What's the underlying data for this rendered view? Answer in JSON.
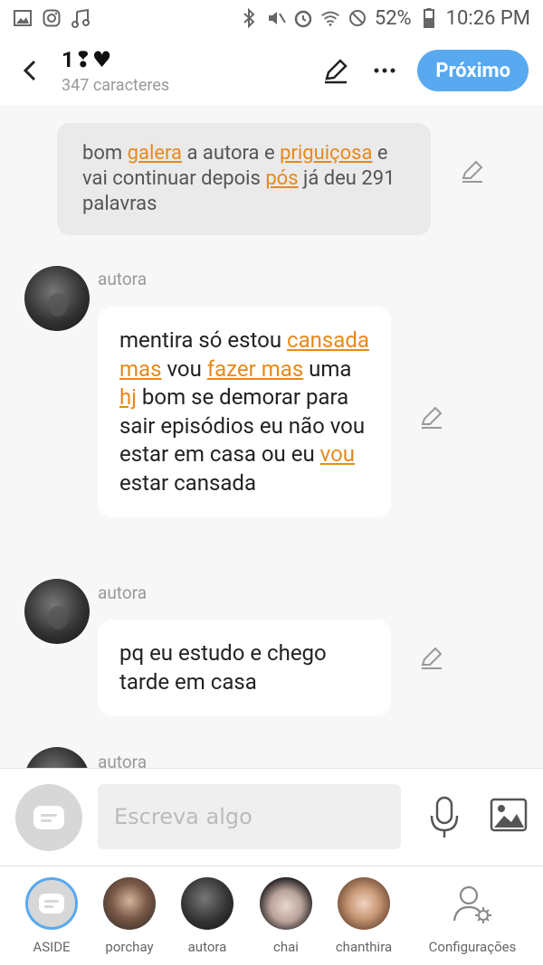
{
  "status": {
    "battery": "52%",
    "time": "10:26 PM"
  },
  "header": {
    "title": "1❢♥",
    "subtitle": "347 caracteres",
    "next_label": "Próximo"
  },
  "messages": [
    {
      "type": "system",
      "segments": [
        {
          "t": "bom ",
          "u": false
        },
        {
          "t": "galera",
          "u": true
        },
        {
          "t": " a autora e ",
          "u": false
        },
        {
          "t": "priguiçosa",
          "u": true
        },
        {
          "t": " e vai continuar depois ",
          "u": false
        },
        {
          "t": "pós",
          "u": true
        },
        {
          "t": " já deu 291 palavras",
          "u": false
        }
      ]
    },
    {
      "type": "message",
      "sender": "autora",
      "segments": [
        {
          "t": "mentira só estou ",
          "u": false
        },
        {
          "t": "cansada mas",
          "u": true
        },
        {
          "t": " vou ",
          "u": false
        },
        {
          "t": "fazer mas",
          "u": true
        },
        {
          "t": " uma ",
          "u": false
        },
        {
          "t": "hj",
          "u": true
        },
        {
          "t": " bom se demorar para sair episódios eu não vou estar em casa ou eu ",
          "u": false
        },
        {
          "t": "vou",
          "u": true
        },
        {
          "t": " estar cansada",
          "u": false
        }
      ]
    },
    {
      "type": "message",
      "sender": "autora",
      "segments": [
        {
          "t": "pq eu estudo e chego tarde em casa",
          "u": false
        }
      ]
    },
    {
      "type": "message",
      "sender": "autora",
      "segments": []
    }
  ],
  "composer": {
    "placeholder": "Escreva algo"
  },
  "nav": [
    {
      "label": "ASIDE",
      "icon": "aside-icon"
    },
    {
      "label": "porchay",
      "icon": "avatar"
    },
    {
      "label": "autora",
      "icon": "avatar"
    },
    {
      "label": "chai",
      "icon": "avatar"
    },
    {
      "label": "chanthira",
      "icon": "avatar"
    },
    {
      "label": "Configurações",
      "icon": "settings-person-icon"
    }
  ],
  "colors": {
    "accent": "#58a9f0",
    "underline": "#e8881b"
  }
}
